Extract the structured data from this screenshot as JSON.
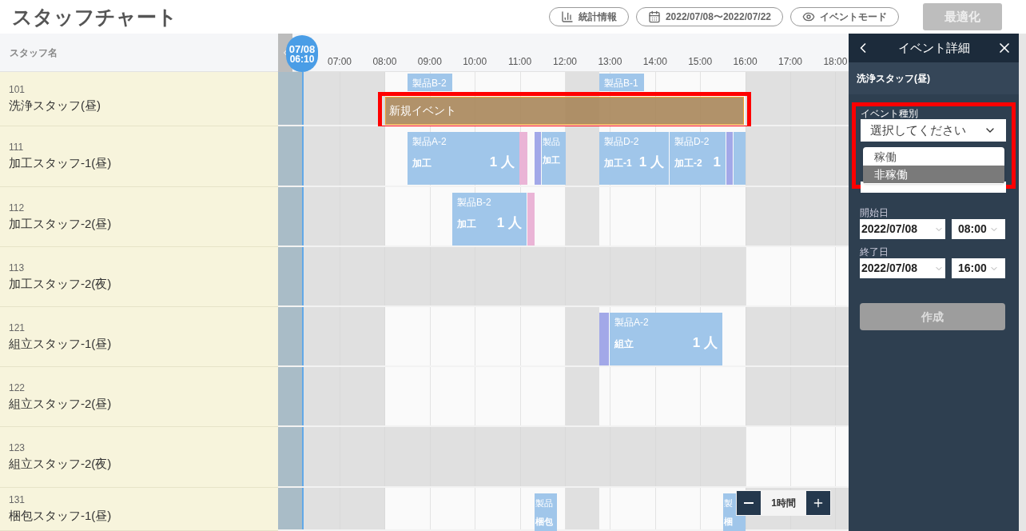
{
  "header": {
    "title": "スタッフチャート",
    "buttons": [
      {
        "kind": "stats",
        "label": "統計情報"
      },
      {
        "kind": "calendar",
        "label": "2022/07/08〜2022/07/22"
      },
      {
        "kind": "eye",
        "label": "イベントモード"
      }
    ],
    "optimize": {
      "label": "最適化",
      "disabled": true
    }
  },
  "chart": {
    "column_header": "スタッフ名",
    "now": {
      "date": "07/08",
      "time": "06:10"
    },
    "hours": [
      "07:00",
      "08:00",
      "09:00",
      "10:00",
      "11:00",
      "12:00",
      "13:00",
      "14:00",
      "15:00",
      "16:00",
      "17:00",
      "18:00"
    ],
    "rows": [
      {
        "code": "101",
        "name": "洗浄スタッフ(昼)",
        "kind": "day",
        "events": [
          {
            "title": "製品B-2",
            "color": "#a0c6ea"
          },
          {
            "title": "製品B-1",
            "color": "#a0c6ea"
          }
        ]
      },
      {
        "code": "111",
        "name": "加工スタッフ-1(昼)",
        "kind": "day",
        "events": [
          {
            "title": "製品A-2",
            "process": "加工",
            "count": "1 人",
            "color": "#a0c6ea"
          },
          {
            "color": "#eab4d6"
          },
          {
            "color": "#a2a8e8"
          },
          {
            "title": "製品",
            "process": "加工",
            "color": "#a0c6ea"
          },
          {
            "title": "製品D-2",
            "process": "加工-1",
            "count": "1 人",
            "color": "#a0c6ea"
          },
          {
            "title": "製品D-2",
            "process": "加工-2",
            "count": "1",
            "color": "#a0c6ea"
          },
          {
            "color": "#a2a8e8"
          },
          {
            "color": "#a0c6ea"
          }
        ]
      },
      {
        "code": "112",
        "name": "加工スタッフ-2(昼)",
        "kind": "day",
        "events": [
          {
            "title": "製品B-2",
            "process": "加工",
            "count": "1 人",
            "color": "#a0c6ea"
          },
          {
            "color": "#eab4d6"
          }
        ]
      },
      {
        "code": "113",
        "name": "加工スタッフ-2(夜)",
        "kind": "night",
        "events": []
      },
      {
        "code": "121",
        "name": "組立スタッフ-1(昼)",
        "kind": "day",
        "events": [
          {
            "color": "#a2a8e8"
          },
          {
            "title": "製品A-2",
            "process": "組立",
            "count": "1 人",
            "color": "#a0c6ea"
          }
        ]
      },
      {
        "code": "122",
        "name": "組立スタッフ-2(昼)",
        "kind": "day",
        "events": []
      },
      {
        "code": "123",
        "name": "組立スタッフ-2(夜)",
        "kind": "night",
        "events": []
      },
      {
        "code": "131",
        "name": "梱包スタッフ-1(昼)",
        "kind": "day",
        "events": [
          {
            "title": "製品",
            "process": "梱包",
            "color": "#a0c6ea"
          },
          {
            "title": "製",
            "process": "梱",
            "color": "#a0c6ea"
          }
        ]
      }
    ],
    "new_event": {
      "label": "新規イベント",
      "selected": true
    }
  },
  "zoom": {
    "label": "1時間"
  },
  "panel": {
    "title": "イベント詳細",
    "staff": "洗浄スタッフ(昼)",
    "type_label": "イベント種別",
    "type_value": "選択してください",
    "options": [
      {
        "label": "稼働",
        "selected": false
      },
      {
        "label": "非稼働",
        "selected": true
      }
    ],
    "start_label": "開始日",
    "start_date": "2022/07/08",
    "start_time": "08:00",
    "end_label": "終了日",
    "end_date": "2022/07/08",
    "end_time": "16:00",
    "create": {
      "label": "作成",
      "disabled": true
    }
  }
}
